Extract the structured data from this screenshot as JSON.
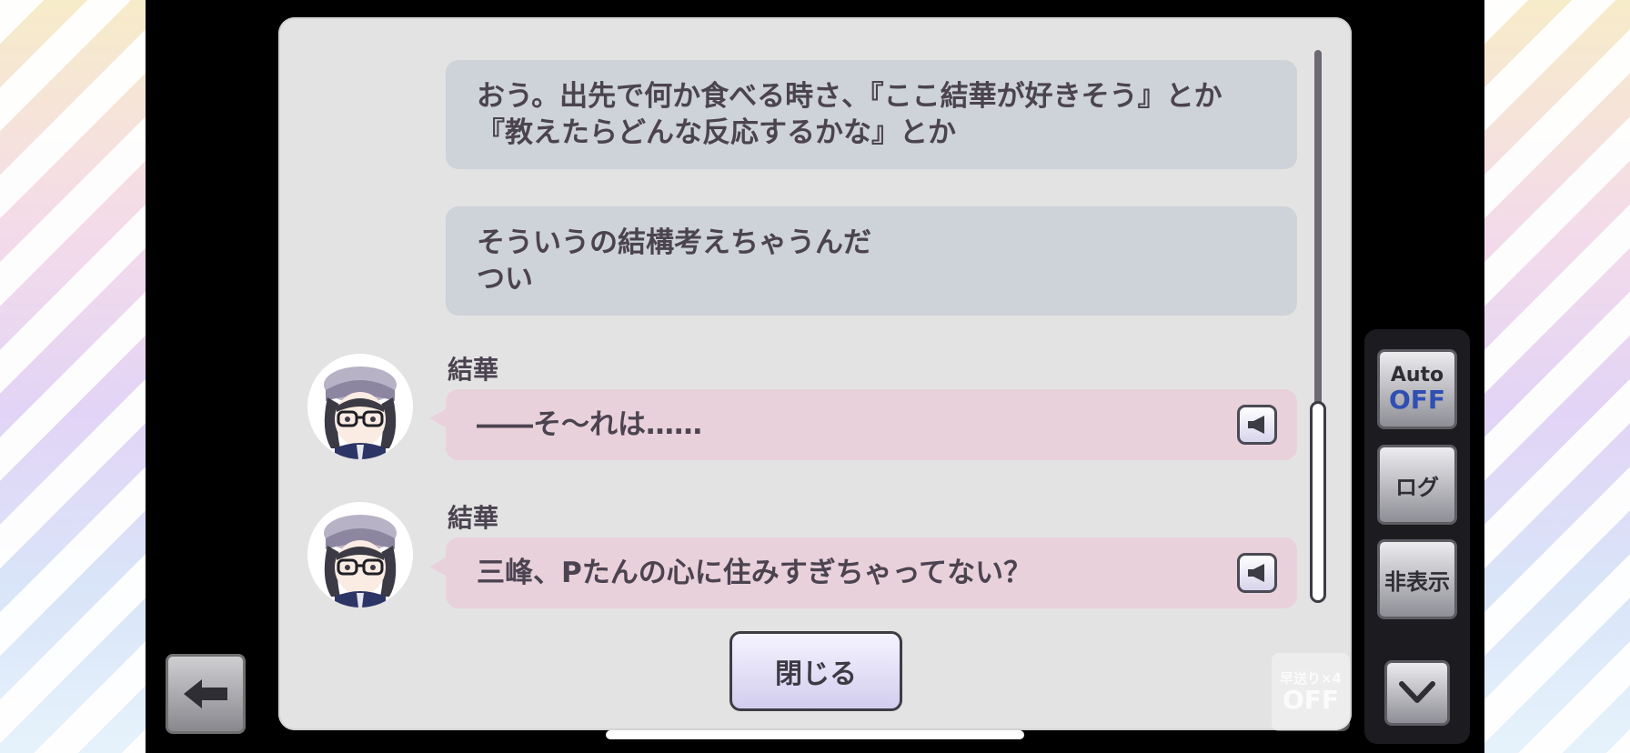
{
  "log": {
    "messages": [
      {
        "type": "narration",
        "text": "おう。出先で何か食べる時さ、『ここ結華が好きそう』とか\n『教えたらどんな反応するかな』とか"
      },
      {
        "type": "narration",
        "text": "そういうの結構考えちゃうんだ\nつい"
      },
      {
        "type": "character",
        "speaker": "結華",
        "text": "――そ～れは……",
        "icon": "speaker-icon"
      },
      {
        "type": "character",
        "speaker": "結華",
        "text": "三峰、Pたんの心に住みすぎちゃってない？",
        "icon": "speaker-icon"
      }
    ],
    "close_label": "閉じる"
  },
  "controls": {
    "back_icon": "arrow-left-icon",
    "auto_label": "Auto",
    "auto_value": "OFF",
    "log_label": "ログ",
    "hide_label": "非表示",
    "fast_forward_label": "早送り×4",
    "fast_forward_value": "OFF",
    "collapse_icon": "chevron-down-icon"
  },
  "colors": {
    "narration_bubble": "#ced2d9",
    "character_bubble": "#e9d1dc",
    "text": "#4b4450",
    "auto_off": "#2f4fb2"
  }
}
